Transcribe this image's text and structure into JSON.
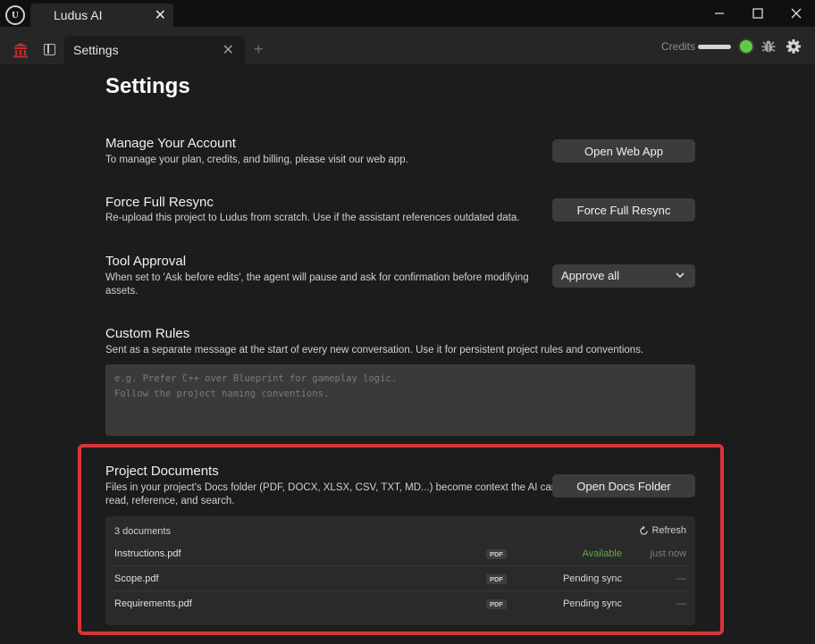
{
  "window": {
    "tab_title": "Ludus AI",
    "tab_close": "✕"
  },
  "app_header": {
    "tab_label": "Settings",
    "tab_close": "✕",
    "new_tab": "+",
    "credits_label": "Credits",
    "credits_level": 1.0,
    "status_color": "#5fcb44"
  },
  "settings": {
    "title": "Settings",
    "account": {
      "title": "Manage Your Account",
      "description": "To manage your plan, credits, and billing, please visit our web app.",
      "button": "Open Web App"
    },
    "resync": {
      "title": "Force Full Resync",
      "description": "Re-upload this project to Ludus from scratch. Use if the assistant references outdated data.",
      "button": "Force Full Resync"
    },
    "tool_approval": {
      "title": "Tool Approval",
      "description_line1": "When set to 'Ask before edits', the agent will pause and ask for confirmation before modifying",
      "description_line2": "assets.",
      "selected": "Approve all"
    },
    "custom_rules": {
      "title": "Custom Rules",
      "description": "Sent as a separate message at the start of every new conversation. Use it for persistent project rules and conventions.",
      "placeholder_line1": "e.g. Prefer C++ over Blueprint for gameplay logic.",
      "placeholder_line2": "Follow the project naming conventions."
    },
    "project_documents": {
      "title": "Project Documents",
      "description_line1": "Files in your project's Docs folder (PDF, DOCX, XLSX, CSV, TXT, MD...) become context the AI can",
      "description_line2": "read, reference, and search.",
      "button": "Open Docs Folder",
      "count": "3 documents",
      "refresh": "Refresh",
      "documents": [
        {
          "name": "Instructions.pdf",
          "type": "PDF",
          "status": "Available",
          "updated": "just now"
        },
        {
          "name": "Scope.pdf",
          "type": "PDF",
          "status": "Pending sync",
          "updated": "—"
        },
        {
          "name": "Requirements.pdf",
          "type": "PDF",
          "status": "Pending sync",
          "updated": "—"
        }
      ]
    }
  },
  "colors": {
    "available": "#5fa843",
    "pending": "#d6d6d6",
    "highlight": "#d9343b"
  },
  "icons": {
    "app": "ludus-temple-icon",
    "engine": "unreal-logo-icon",
    "debug": "bug-icon",
    "settings": "gear-icon"
  }
}
